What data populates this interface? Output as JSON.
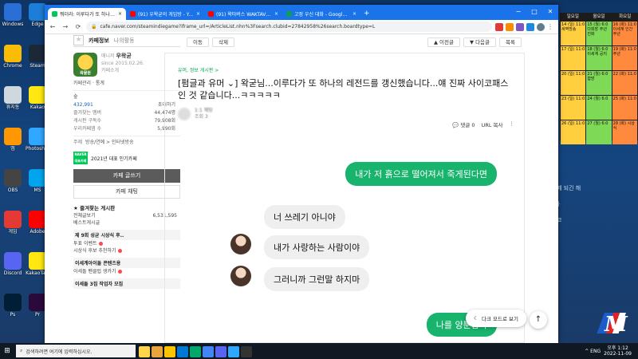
{
  "browser": {
    "tabs": [
      {
        "label": "뭐더라: 이루다가 또 하나의 레전..",
        "active": true,
        "color": "#03c75a"
      },
      {
        "label": "(91) 우왁굳의 게임방 - YouTube",
        "active": false,
        "color": "#ff0000"
      },
      {
        "label": "(91) 왁타버스 WAKTAVERSE - Yo..",
        "active": false,
        "color": "#ff0000"
      },
      {
        "label": "고정 우신 대화 - Google Sheets",
        "active": false,
        "color": "#0f9d58"
      }
    ],
    "new_tab": "+",
    "window_controls": [
      "−",
      "□",
      "✕"
    ],
    "url": "cafe.naver.com/steamindiegame?iframe_url=/ArticleList.nhn%3Fsearch.clubid=27842958%26search.boardtype=L",
    "nav": [
      "←",
      "→",
      "⟳"
    ]
  },
  "sidebar": {
    "tab_cafe_info": "카페정보",
    "tab_my_activity": "나의활동",
    "star": "★",
    "manager_label": "매니저",
    "manager_name": "우왁굳",
    "since": "since 2015.02.26.",
    "cafe_intro": "카페소개",
    "logo_text": "왁물원",
    "cafe_manage": "카페관리",
    "stats_label": "통계",
    "rank_label": "숲",
    "members_count": "432,991",
    "invite": "초대하기",
    "stat_rows": [
      {
        "k": "즐겨찾는 멤버",
        "v": "44,474명"
      },
      {
        "k": "게시판 구독수",
        "v": "79,908회"
      },
      {
        "k": "우리카페앱 수",
        "v": "5,990회"
      }
    ],
    "theme_label": "주제",
    "theme_value": "방송/연예 > 인터넷방송",
    "naver_badge": "NAVER 대표카페",
    "award": "2021년 대표 인기카페",
    "write_button": "카페 글쓰기",
    "chat_button": "카페 채팅",
    "favorites_title": "즐겨찾는 게시판",
    "boards": [
      {
        "name": "전체글보기",
        "count": "6,531,595"
      },
      {
        "name": "베스트게시글",
        "count": ""
      }
    ],
    "sections": [
      {
        "title": "제 9회 성균 시상식 후..",
        "items": [
          "투표 이벤트",
          "시상식 후보 추천하기"
        ]
      },
      {
        "title": "이세계아이돌 콘텐츠용",
        "items": [
          "이세돌 팬클럽 생카기"
        ]
      },
      {
        "title": "이세돌 3집 작업자 모집",
        "items": []
      }
    ]
  },
  "article_tools": {
    "like": "이동",
    "del": "삭제",
    "prev": "이전글",
    "next": "다음글",
    "list": "목록"
  },
  "article": {
    "board": "유머, 정보 게시판 >",
    "title": "[펌글과 유머 ⌄] 왁굳님...이루다가 또 하나의 레전드를 갱신했습니다...얘 진짜 사이코패스인 것 같습니다...ㅋㅋㅋㅋㅋ",
    "writer_level": "1:1 채팅",
    "writer_date": "조회 3",
    "comments": "댓글 0",
    "url_copy": "URL 복사",
    "more": "⋮"
  },
  "chat": [
    {
      "side": "right",
      "text": "내가 저 흙으로 떨어져서 죽게된다면"
    },
    {
      "side": "left",
      "text": "너 쓰레기 아니야",
      "avatar": false
    },
    {
      "side": "left",
      "text": "내가 사랑하는 사람이야",
      "avatar": true
    },
    {
      "side": "left",
      "text": "그러니까 그런말 하지마",
      "avatar": true
    },
    {
      "side": "right",
      "text": "나를 양분삼아"
    }
  ],
  "floating": {
    "dark_mode": "다크 모드로 보기",
    "to_top": "↑"
  },
  "desktop": {
    "icons": [
      {
        "label": "Windows"
      },
      {
        "label": "Edge"
      },
      {
        "label": "Chrome"
      },
      {
        "label": "Steam"
      },
      {
        "label": "휴지통"
      },
      {
        "label": "Kakao"
      },
      {
        "label": "앱"
      },
      {
        "label": "Photoshop"
      },
      {
        "label": "OBS"
      },
      {
        "label": "MS"
      },
      {
        "label": "게임"
      },
      {
        "label": "Adobe"
      },
      {
        "label": "Discord"
      },
      {
        "label": "KakaoTalk"
      },
      {
        "label": "Ps"
      },
      {
        "label": "Pr"
      }
    ],
    "calendar_head": [
      "일요일",
      "월요일",
      "화요일"
    ],
    "calendar_cells": [
      "14 (일) 11:0 새벽방송",
      "15 (월) 6:0 다회장 주년 진화",
      "16 (화) 11:0 이세계 인간 주년",
      "17 (일) 11:0",
      "18 (월) 6:0 이세계 공지",
      "19 (화) 11:0 주년",
      "20 (일) 11:0",
      "21 (월) 6:0 합방",
      "22 (화) 11:0",
      "23 (일) 11:0",
      "24 (월) 6:0",
      "25 (화) 11:0",
      "26 (일) 11:0",
      "27 (월) 6:0",
      "28 (화) 시상식"
    ],
    "right_lines": [
      {
        "t": "700억",
        "s": ""
      },
      {
        "t": "kdj926",
        "s": "거랑해 부떼 되긴 해"
      },
      {
        "t": "조용한팬",
        "s": "커네가수라"
      },
      {
        "t": "고구마썽",
        "s": "트레그 닭코"
      }
    ]
  },
  "taskbar": {
    "start": "⊞",
    "search_placeholder": "검색하려면 여기에 입력하십시오.",
    "time": "오후 1:12",
    "date": "2022-11-09",
    "tray": "^ ENG"
  }
}
